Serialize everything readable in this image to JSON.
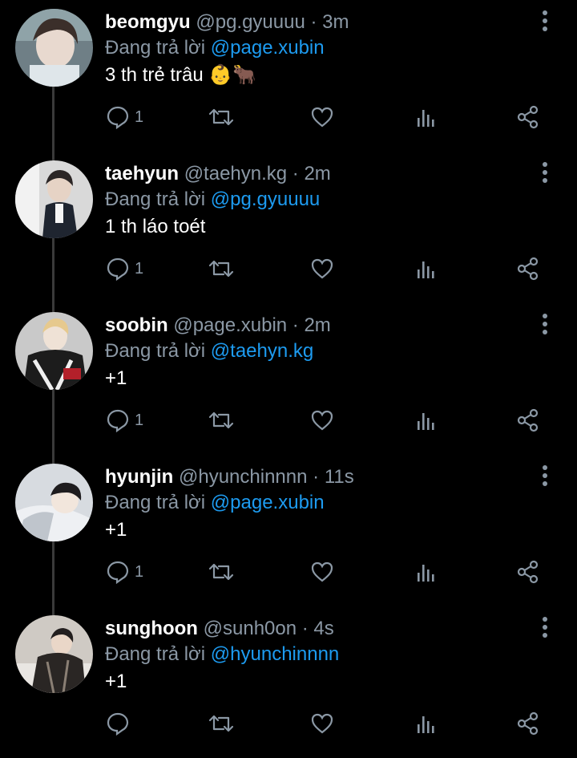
{
  "colors": {
    "background": "#000000",
    "name": "#ffffff",
    "meta": "#8b98a5",
    "mention": "#1d9bf0"
  },
  "icons": [
    "reply-icon",
    "retweet-icon",
    "like-icon",
    "stats-icon",
    "share-icon",
    "more-icon"
  ],
  "tweets": [
    {
      "name": "beomgyu",
      "handle": "@pg.gyuuuu",
      "time": "· 3m",
      "reply_prefix": "Đang trả lời",
      "reply_to": "@page.xubin",
      "text": "3 th trẻ trâu 👶🐂",
      "reply_count": "1"
    },
    {
      "name": "taehyun",
      "handle": "@taehyn.kg",
      "time": "· 2m",
      "reply_prefix": "Đang trả lời",
      "reply_to": "@pg.gyuuuu",
      "text": "1 th láo toét",
      "reply_count": "1"
    },
    {
      "name": "soobin",
      "handle": "@page.xubin",
      "time": "· 2m",
      "reply_prefix": "Đang trả lời",
      "reply_to": "@taehyn.kg",
      "text": "+1",
      "reply_count": "1"
    },
    {
      "name": "hyunjin",
      "handle": "@hyunchinnnn",
      "time": "· 11s",
      "reply_prefix": "Đang trả lời",
      "reply_to": "@page.xubin",
      "text": "+1",
      "reply_count": "1"
    },
    {
      "name": "sunghoon",
      "handle": "@sunh0on",
      "time": "· 4s",
      "reply_prefix": "Đang trả lời",
      "reply_to": "@hyunchinnnn",
      "text": "+1",
      "reply_count": ""
    }
  ]
}
